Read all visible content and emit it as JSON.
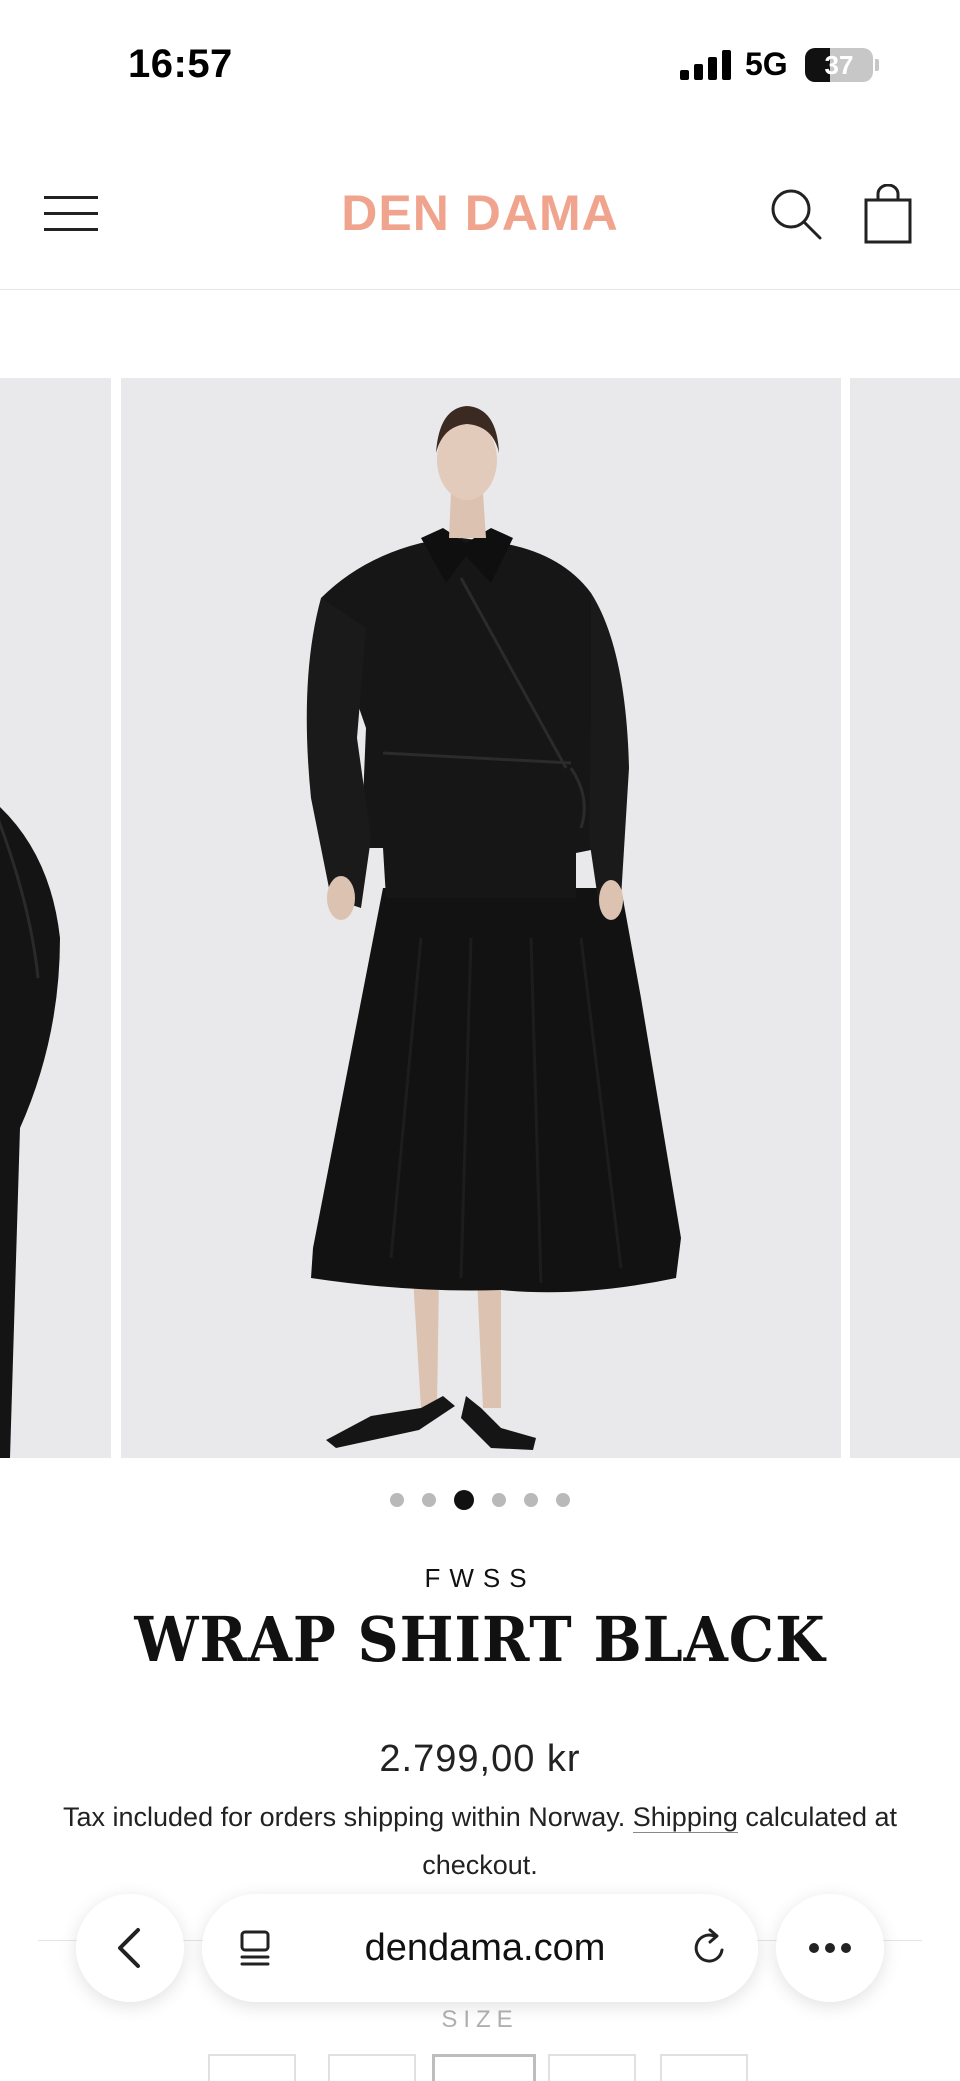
{
  "status_bar": {
    "time": "16:57",
    "network": "5G",
    "battery": "37",
    "battery_level": 0.37
  },
  "header": {
    "logo": "DEN DAMA",
    "logo_color": "#f0a48e"
  },
  "gallery": {
    "slide_count": 6,
    "active_slide": 3
  },
  "product": {
    "brand": "FWSS",
    "title": "WRAP SHIRT BLACK",
    "price": "2.799,00 kr",
    "tax_note_before": "Tax included for orders shipping within Norway.",
    "tax_link": "Shipping",
    "tax_note_after": "calculated at checkout.",
    "size_label": "SIZE"
  },
  "browser": {
    "url": "dendama.com"
  },
  "icons": {
    "menu": "hamburger-menu-icon",
    "search": "search-icon",
    "bag": "shopping-bag-icon",
    "zoom": "zoom-icon",
    "back": "chevron-left-icon",
    "tabs": "tab-overview-icon",
    "reload": "reload-icon",
    "more": "more-icon"
  }
}
